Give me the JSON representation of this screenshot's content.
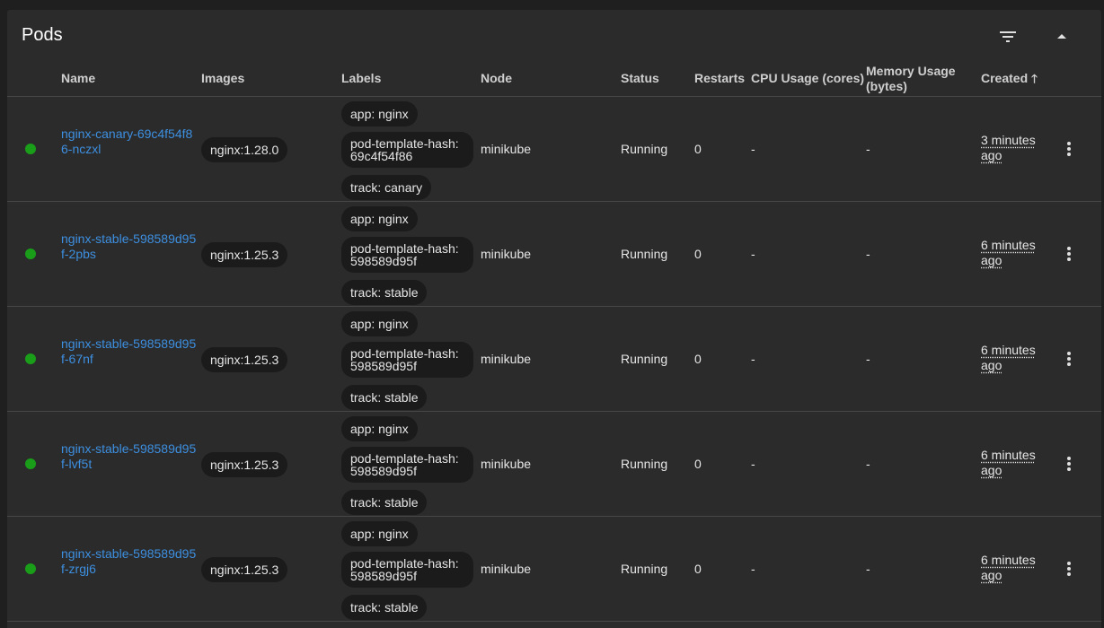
{
  "card": {
    "title": "Pods"
  },
  "columns": {
    "name": "Name",
    "images": "Images",
    "labels": "Labels",
    "node": "Node",
    "status": "Status",
    "restarts": "Restarts",
    "cpu": "CPU Usage (cores)",
    "memory": "Memory Usage (bytes)",
    "created": "Created",
    "created_sort_icon": "arrow-up-icon"
  },
  "colors": {
    "running": "#1a9e1a",
    "link": "#3d8fe0"
  },
  "pods": [
    {
      "name": "nginx-canary-69c4f54f86-nczxl",
      "image": "nginx:1.28.0",
      "labels": [
        "app: nginx",
        "pod-template-hash: 69c4f54f86",
        "track: canary"
      ],
      "node": "minikube",
      "status": "Running",
      "restarts": "0",
      "cpu": "-",
      "memory": "-",
      "created": "3 minutes ago"
    },
    {
      "name": "nginx-stable-598589d95f-2pbs",
      "image": "nginx:1.25.3",
      "labels": [
        "app: nginx",
        "pod-template-hash: 598589d95f",
        "track: stable"
      ],
      "node": "minikube",
      "status": "Running",
      "restarts": "0",
      "cpu": "-",
      "memory": "-",
      "created": "6 minutes ago"
    },
    {
      "name": "nginx-stable-598589d95f-67nf",
      "image": "nginx:1.25.3",
      "labels": [
        "app: nginx",
        "pod-template-hash: 598589d95f",
        "track: stable"
      ],
      "node": "minikube",
      "status": "Running",
      "restarts": "0",
      "cpu": "-",
      "memory": "-",
      "created": "6 minutes ago"
    },
    {
      "name": "nginx-stable-598589d95f-lvf5t",
      "image": "nginx:1.25.3",
      "labels": [
        "app: nginx",
        "pod-template-hash: 598589d95f",
        "track: stable"
      ],
      "node": "minikube",
      "status": "Running",
      "restarts": "0",
      "cpu": "-",
      "memory": "-",
      "created": "6 minutes ago"
    },
    {
      "name": "nginx-stable-598589d95f-zrgj6",
      "image": "nginx:1.25.3",
      "labels": [
        "app: nginx",
        "pod-template-hash: 598589d95f",
        "track: stable"
      ],
      "node": "minikube",
      "status": "Running",
      "restarts": "0",
      "cpu": "-",
      "memory": "-",
      "created": "6 minutes ago"
    }
  ]
}
